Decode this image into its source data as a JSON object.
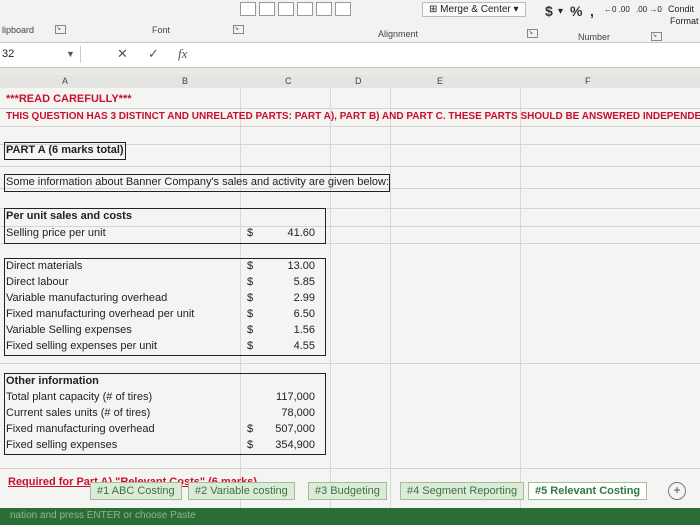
{
  "ribbon": {
    "clipboard_label": "lipboard",
    "font_label": "Font",
    "alignment_label": "Alignment",
    "number_label": "Number",
    "merge_center": "Merge & Center",
    "currency": "$",
    "percent": "%",
    "comma": ",",
    "dec_inc": "←0 .00",
    "dec_dec": ".00 →0",
    "conditional": "Condit",
    "format": "Format"
  },
  "formula_bar": {
    "name_box": "32",
    "cancel": "✕",
    "enter": "✓",
    "fx": "fx",
    "value": ""
  },
  "columns": [
    "A",
    "B",
    "C",
    "D",
    "E",
    "F"
  ],
  "content": {
    "read_carefully": "***READ CAREFULLY***",
    "question_note": "THIS QUESTION HAS 3 DISTINCT AND UNRELATED PARTS: PART A), PART B) AND PART C. THESE PARTS SHOULD BE ANSWERED INDEPENDENTL",
    "part_a": "PART A (6 marks total)",
    "intro": "Some information about Banner Company's sales and activity are given below:",
    "per_unit_header": "Per unit sales and costs",
    "selling_price_label": "Selling price per unit",
    "selling_price_dollar": "$",
    "selling_price_value": "41.60",
    "costs": [
      {
        "label": "Direct materials",
        "dollar": "$",
        "value": "13.00"
      },
      {
        "label": "Direct labour",
        "dollar": "$",
        "value": "5.85"
      },
      {
        "label": "Variable manufacturing overhead",
        "dollar": "$",
        "value": "2.99"
      },
      {
        "label": "Fixed manufacturing overhead per unit",
        "dollar": "$",
        "value": "6.50"
      },
      {
        "label": "Variable Selling expenses",
        "dollar": "$",
        "value": "1.56"
      },
      {
        "label": "Fixed selling expenses per unit",
        "dollar": "$",
        "value": "4.55"
      }
    ],
    "other_header": "Other information",
    "other": [
      {
        "label": "Total plant capacity (# of tires)",
        "dollar": "",
        "value": "117,000"
      },
      {
        "label": "Current sales units (# of tires)",
        "dollar": "",
        "value": "78,000"
      },
      {
        "label": "Fixed manufacturing overhead",
        "dollar": "$",
        "value": "507,000"
      },
      {
        "label": "Fixed selling expenses",
        "dollar": "$",
        "value": "354,900"
      }
    ],
    "required": "Required for Part A) \"Relevant Costs\" (6 marks)"
  },
  "tabs": [
    {
      "label": "#1 ABC Costing"
    },
    {
      "label": "#2 Variable costing"
    },
    {
      "label": "#3 Budgeting"
    },
    {
      "label": "#4 Segment Reporting"
    },
    {
      "label": "#5 Relevant Costing"
    }
  ],
  "add_sheet": "+",
  "status_text": "nation and press ENTER or choose Paste"
}
